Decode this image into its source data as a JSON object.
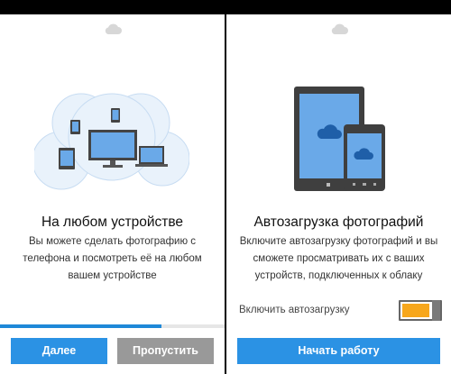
{
  "left": {
    "title": "На любом устройстве",
    "body": "Вы можете сделать фотографию с\nтелефона и посмотреть её на любом\nвашем устройстве",
    "progress": 0.72,
    "next_label": "Далее",
    "skip_label": "Пропустить"
  },
  "right": {
    "title": "Автозагрузка фотографий",
    "body": "Включите автозагрузку фотографий и вы\nсможете просматривать их с ваших\nустройств, подключенных к облаку",
    "toggle_label": "Включить автозагрузку",
    "toggle_on": true,
    "start_label": "Начать работу"
  },
  "colors": {
    "accent": "#2b92e4",
    "progress": "#1e88d8",
    "toggle_on": "#f7a71c",
    "secondary_button": "#999999",
    "device_frame": "#3f3f3f",
    "device_screen": "#6aa9e8"
  }
}
